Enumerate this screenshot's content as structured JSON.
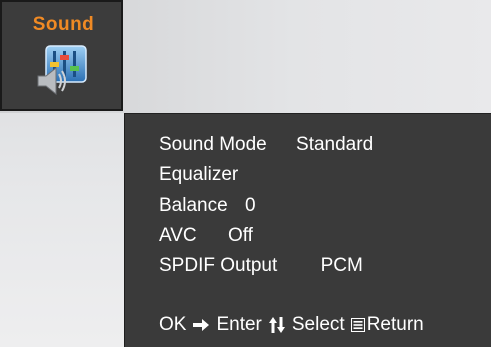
{
  "tab": {
    "title": "Sound",
    "icon": "speaker-equalizer-icon",
    "accent_color": "#f08a24"
  },
  "menu": {
    "items": [
      {
        "label": "Sound Mode",
        "value": "Standard"
      },
      {
        "label": "Equalizer",
        "value": ""
      },
      {
        "label": "Balance",
        "value": "0"
      },
      {
        "label": "AVC",
        "value": "Off"
      },
      {
        "label": "SPDIF Output",
        "value": "PCM"
      }
    ]
  },
  "footer": {
    "ok_label": "OK",
    "ok_icon": "arrow-right-icon",
    "enter_label": "Enter",
    "select_icon": "up-down-arrows-icon",
    "select_label": "Select",
    "return_icon": "menu-icon",
    "return_label": "Return"
  }
}
